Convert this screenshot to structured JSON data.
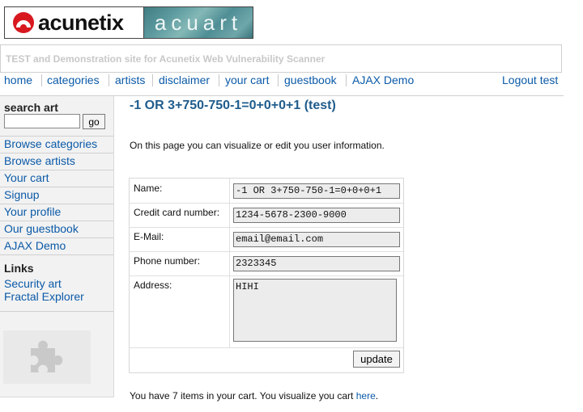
{
  "logo": {
    "brand": "acunetix",
    "site": "acuart"
  },
  "subtitle": "TEST and Demonstration site for Acunetix Web Vulnerability Scanner",
  "nav": {
    "items": [
      "home",
      "categories",
      "artists",
      "disclaimer",
      "your cart",
      "guestbook",
      "AJAX Demo"
    ],
    "logout": "Logout test"
  },
  "sidebar": {
    "search_title": "search art",
    "search_value": "",
    "go_label": "go",
    "links": [
      "Browse categories",
      "Browse artists",
      "Your cart",
      "Signup",
      "Your profile",
      "Our guestbook",
      "AJAX Demo"
    ],
    "links_title": "Links",
    "external_links": [
      "Security art",
      "Fractal Explorer"
    ]
  },
  "main": {
    "title": "-1 OR 3+750-750-1=0+0+0+1 (test)",
    "intro": "On this page you can visualize or edit you user information.",
    "form": {
      "name_label": "Name:",
      "name_value": "-1 OR 3+750-750-1=0+0+0+1",
      "cc_label": "Credit card number:",
      "cc_value": "1234-5678-2300-9000",
      "email_label": "E-Mail:",
      "email_value": "email@email.com",
      "phone_label": "Phone number:",
      "phone_value": "2323345",
      "address_label": "Address:",
      "address_value": "HIHI",
      "update_label": "update"
    },
    "cart_text": "You have 7 items in your cart. You visualize you cart ",
    "cart_link": "here",
    "cart_end": "."
  },
  "colors": {
    "link": "#0b5aa8",
    "title": "#1f5c8c",
    "sidebar_bg": "#f2f2f2",
    "logo_red": "#d7191f"
  }
}
